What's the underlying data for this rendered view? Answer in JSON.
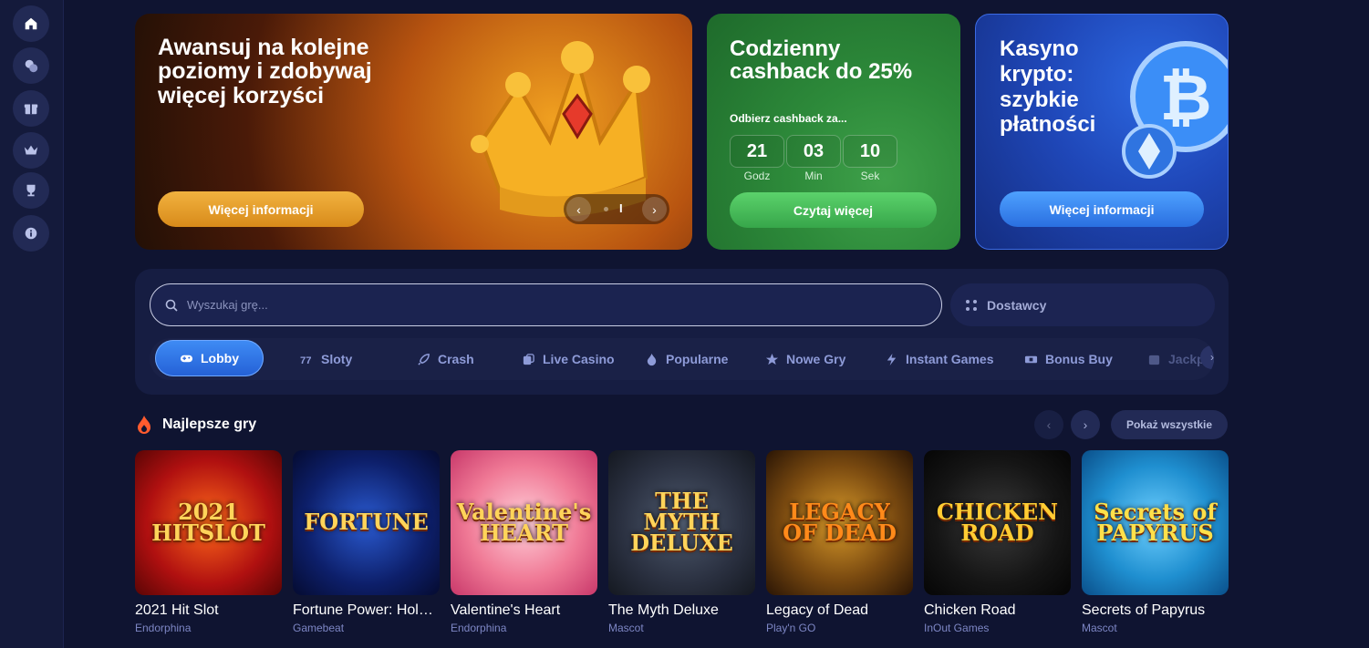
{
  "sidebar": {
    "items": [
      {
        "name": "home-icon"
      },
      {
        "name": "casino-chips-icon"
      },
      {
        "name": "gift-icon"
      },
      {
        "name": "crown-icon"
      },
      {
        "name": "trophy-icon"
      },
      {
        "name": "info-icon"
      }
    ]
  },
  "banners": {
    "levels": {
      "title": "Awansuj na kolejne poziomy i zdobywaj więcej korzyści",
      "button": "Więcej informacji",
      "page_indicator": "I"
    },
    "cashback": {
      "title": "Codzienny cashback do 25%",
      "subtitle": "Odbierz cashback za...",
      "timer": [
        {
          "value": "21",
          "label": "Godz"
        },
        {
          "value": "03",
          "label": "Min"
        },
        {
          "value": "10",
          "label": "Sek"
        }
      ],
      "button": "Czytaj więcej"
    },
    "crypto": {
      "title": "Kasyno krypto: szybkie płatności",
      "button": "Więcej informacji"
    }
  },
  "search": {
    "placeholder": "Wyszukaj grę..."
  },
  "providers": {
    "label": "Dostawcy"
  },
  "tabs": [
    {
      "label": "Lobby",
      "icon": "gamepad-icon",
      "active": true
    },
    {
      "label": "Sloty",
      "icon": "slots-icon"
    },
    {
      "label": "Crash",
      "icon": "rocket-icon"
    },
    {
      "label": "Live Casino",
      "icon": "dice-icon"
    },
    {
      "label": "Popularne",
      "icon": "flame-icon"
    },
    {
      "label": "Nowe Gry",
      "icon": "star-icon"
    },
    {
      "label": "Instant Games",
      "icon": "lightning-icon"
    },
    {
      "label": "Bonus Buy",
      "icon": "ticket-icon"
    },
    {
      "label": "Jackpot",
      "icon": "jackpot-icon"
    }
  ],
  "section": {
    "title": "Najlepsze gry",
    "show_all": "Pokaż wszystkie"
  },
  "games": [
    {
      "title": "2021 Hit Slot",
      "provider": "Endorphina",
      "thumb_text": "2021 HITSLOT"
    },
    {
      "title": "Fortune Power: Hold & Win",
      "provider": "Gamebeat",
      "thumb_text": "FORTUNE"
    },
    {
      "title": "Valentine's Heart",
      "provider": "Endorphina",
      "thumb_text": "Valentine's HEART"
    },
    {
      "title": "The Myth Deluxe",
      "provider": "Mascot",
      "thumb_text": "THE MYTH DELUXE"
    },
    {
      "title": "Legacy of Dead",
      "provider": "Play'n GO",
      "thumb_text": "LEGACY OF DEAD"
    },
    {
      "title": "Chicken Road",
      "provider": "InOut Games",
      "thumb_text": "CHICKEN ROAD"
    },
    {
      "title": "Secrets of Papyrus",
      "provider": "Mascot",
      "thumb_text": "Secrets of PAPYRUS"
    }
  ]
}
